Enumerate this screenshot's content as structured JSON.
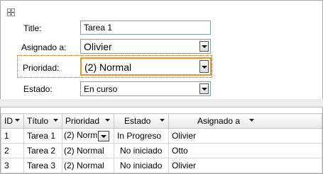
{
  "form": {
    "title_label": "Title:",
    "title_value": "Tarea 1",
    "assigned_label": "Asignado a:",
    "assigned_value": "Olivier",
    "priority_label": "Prioridad:",
    "priority_value": "(2) Normal",
    "status_label": "Estado:",
    "status_value": "En curso"
  },
  "grid": {
    "headers": [
      "ID",
      "Título",
      "Prioridad",
      "Estado",
      "Asignado a"
    ],
    "rows": [
      {
        "id": "1",
        "title": "Tarea 1",
        "priority": "(2) Norm",
        "status": "In Progreso",
        "assigned": "Olivier"
      },
      {
        "id": "2",
        "title": "Tarea 2",
        "priority": "(2) Normal",
        "status": "No iniciado",
        "assigned": "Otto"
      },
      {
        "id": "3",
        "title": "Tarea 3",
        "priority": "(2) Normal",
        "status": "No iniciado",
        "assigned": "Olivier"
      }
    ]
  },
  "colors": {
    "focus_border": "#e8962a",
    "field_border": "#7f9db9",
    "header_separator": "#ececec"
  }
}
